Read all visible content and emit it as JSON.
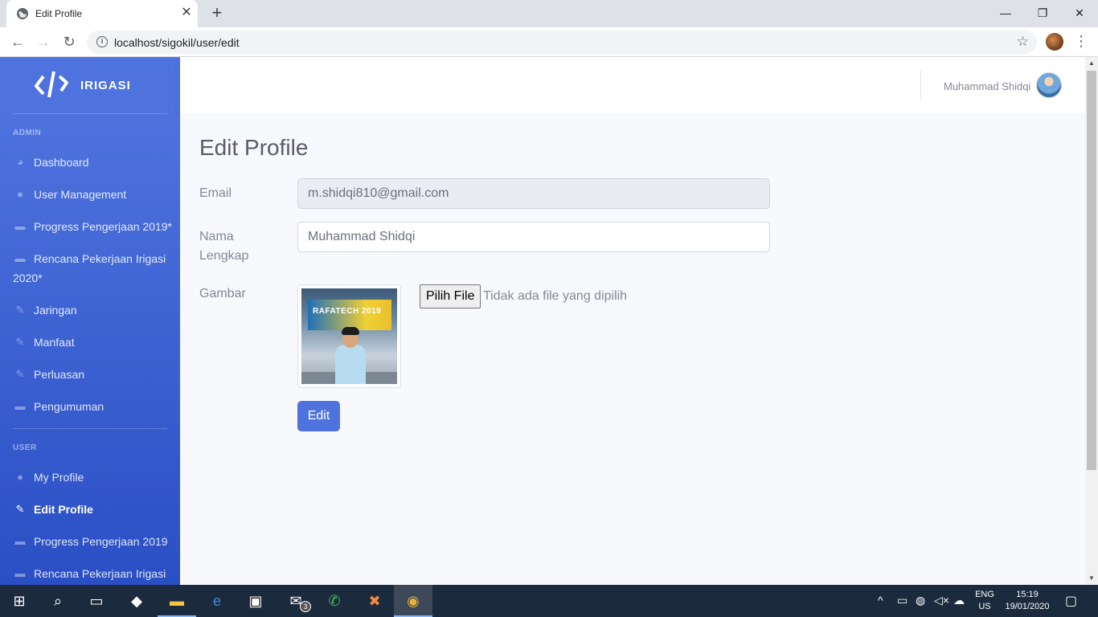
{
  "browser": {
    "tab_title": "Edit Profile",
    "url": "localhost/sigokil/user/edit",
    "tab_close": "✕",
    "new_tab": "+",
    "win_minimize": "—",
    "win_restore": "❐",
    "win_close": "✕"
  },
  "sidebar": {
    "brand": "IRIGASI",
    "admin_heading": "ADMIN",
    "user_heading": "USER",
    "admin_items": [
      {
        "label": "Dashboard",
        "icon": "tachometer-icon"
      },
      {
        "label": "User Management",
        "icon": "user-icon"
      },
      {
        "label": "Progress Pengerjaan 2019*",
        "icon": "handshake-icon"
      },
      {
        "label": "Rencana Pekerjaan Irigasi 2020*",
        "icon": "handshake-icon"
      },
      {
        "label": "Jaringan",
        "icon": "edit-icon"
      },
      {
        "label": "Manfaat",
        "icon": "edit-icon"
      },
      {
        "label": "Perluasan",
        "icon": "edit-icon"
      },
      {
        "label": "Pengumuman",
        "icon": "handshake-icon"
      }
    ],
    "user_items": [
      {
        "label": "My Profile",
        "icon": "user-icon"
      },
      {
        "label": "Edit Profile",
        "icon": "edit-icon",
        "active": true
      },
      {
        "label": "Progress Pengerjaan 2019",
        "icon": "handshake-icon"
      },
      {
        "label": "Rencana Pekerjaan Irigasi",
        "icon": "handshake-icon"
      }
    ]
  },
  "topbar": {
    "user_name": "Muhammad Shidqi"
  },
  "page": {
    "title": "Edit Profile",
    "email_label": "Email",
    "email_value": "m.shidqi810@gmail.com",
    "name_label": "Nama Lengkap",
    "name_value": "Muhammad Shidqi",
    "image_label": "Gambar",
    "photo_banner": "RAFATECH 2019",
    "file_button": "Pilih File",
    "file_status": "Tidak ada file yang dipilih",
    "submit_label": "Edit"
  },
  "taskbar": {
    "lang_top": "ENG",
    "lang_bottom": "US",
    "time": "15:19",
    "date": "19/01/2020",
    "mail_badge": "3"
  },
  "colors": {
    "sidebar_primary": "#4e73df",
    "button_primary": "#4e73df",
    "content_bg": "#f8f9fc",
    "taskbar_bg": "#1c2a3d"
  }
}
